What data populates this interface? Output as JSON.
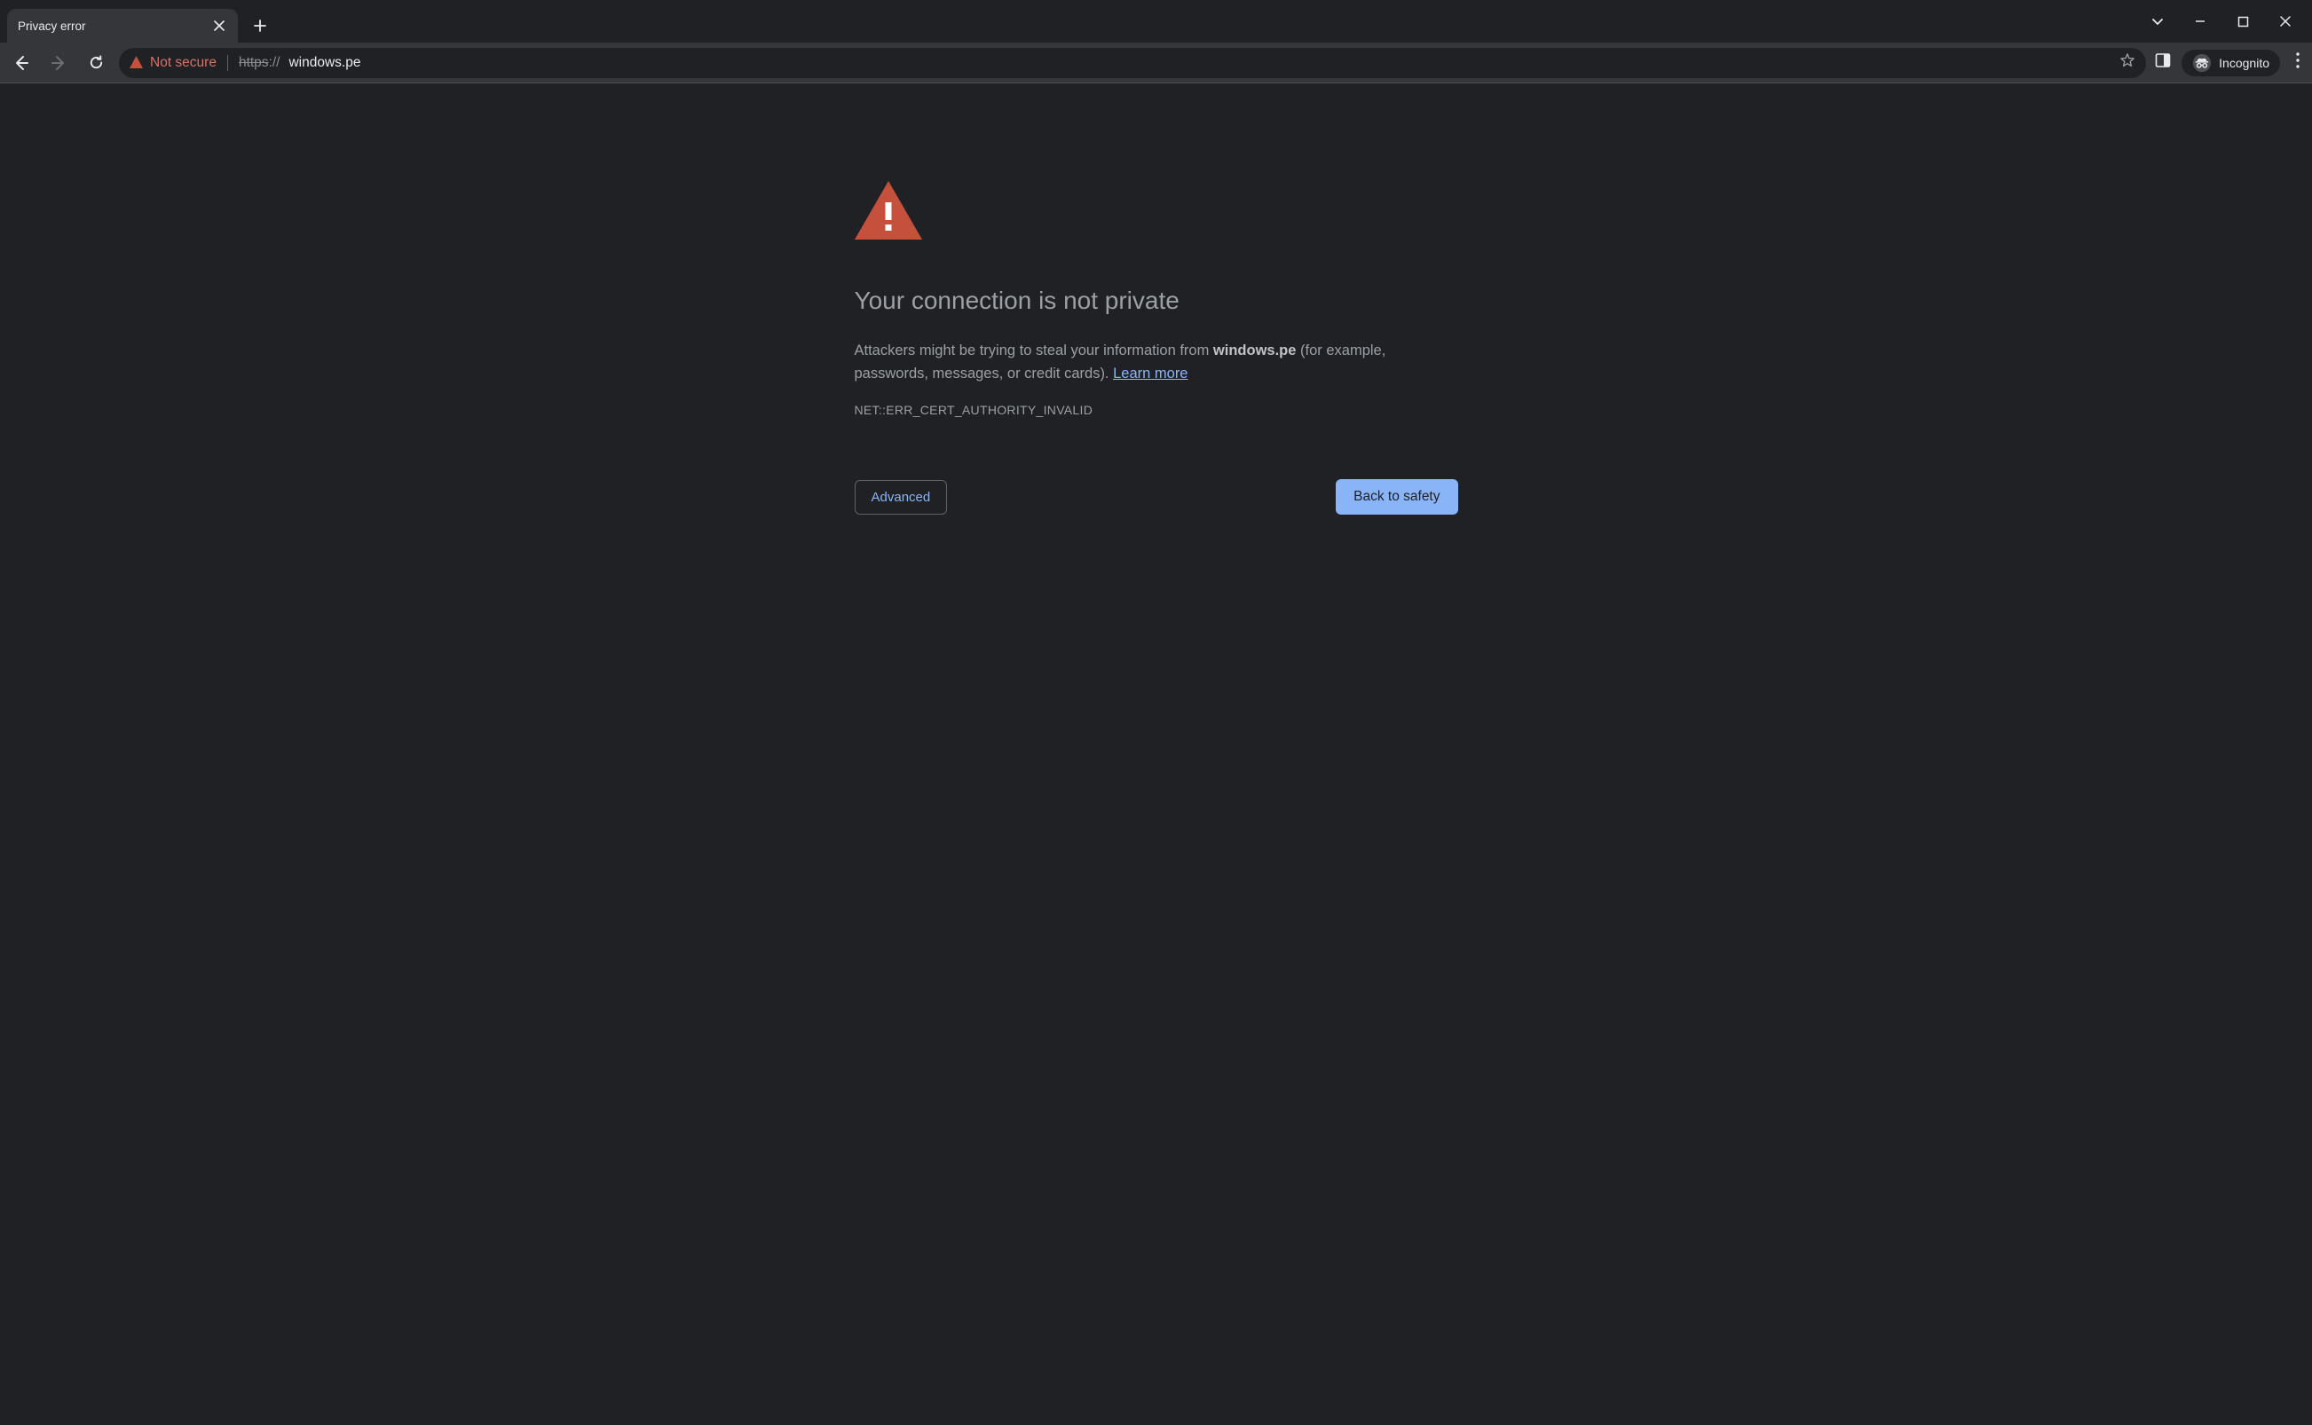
{
  "tab": {
    "title": "Privacy error"
  },
  "toolbar": {
    "not_secure_label": "Not secure",
    "url_protocol": "https",
    "url_sep": "://",
    "url_host": "windows.pe",
    "incognito_label": "Incognito"
  },
  "page": {
    "heading": "Your connection is not private",
    "body_prefix": "Attackers might be trying to steal your information from ",
    "body_domain": "windows.pe",
    "body_suffix": " (for example, passwords, messages, or credit cards). ",
    "learn_more": "Learn more",
    "error_code": "NET::ERR_CERT_AUTHORITY_INVALID",
    "advanced_label": "Advanced",
    "back_label": "Back to safety"
  },
  "colors": {
    "danger": "#cf6679",
    "warning_triangle": "#c5513d",
    "link": "#8ab4f8"
  }
}
